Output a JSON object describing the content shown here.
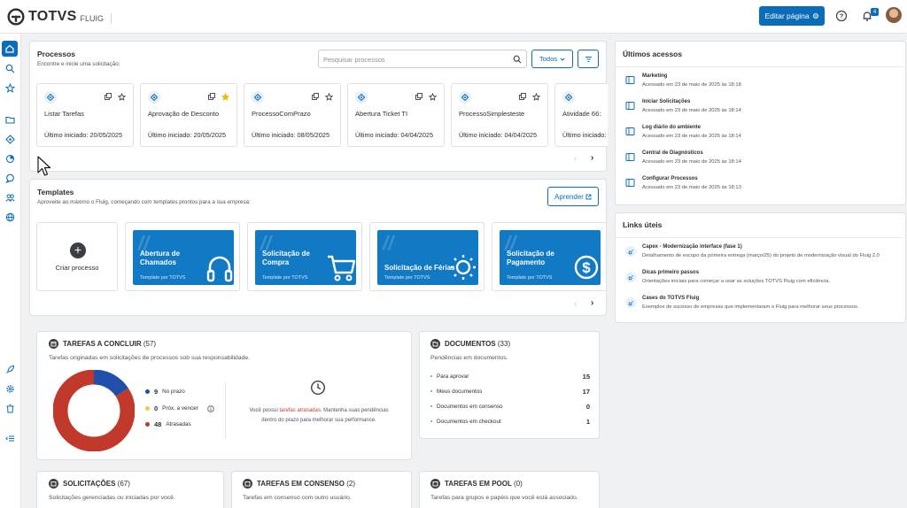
{
  "topbar": {
    "brand": "TOTVS",
    "product": "FLUIG",
    "edit_button": "Editar página",
    "notification_count": "4"
  },
  "colors": {
    "primary": "#0b6cb7",
    "no_prazo": "#1f4fa8",
    "prox_vencer": "#f2c94c",
    "atrasadas": "#c0392b"
  },
  "processes": {
    "title": "Processos",
    "subtitle": "Encontre e inicie uma solicitação:",
    "search_placeholder": "Pesquisar processos",
    "filter_label": "Todos",
    "items": [
      {
        "name": "Listar Tarefas",
        "last_started": "Último iniciado: 20/05/2025",
        "favorite": false
      },
      {
        "name": "Aprovação de Desconto",
        "last_started": "Último iniciado: 20/05/2025",
        "favorite": true
      },
      {
        "name": "ProcessoComPrazo",
        "last_started": "Último iniciado: 08/05/2025",
        "favorite": false
      },
      {
        "name": "Abertura Ticket TI",
        "last_started": "Último iniciado: 04/04/2025",
        "favorite": false
      },
      {
        "name": "ProcessoSimplesteste",
        "last_started": "Último iniciado: 04/04/2025",
        "favorite": false
      },
      {
        "name": "Atividade 66:",
        "last_started": "Último iniciado:",
        "favorite": false
      }
    ]
  },
  "templates": {
    "title": "Templates",
    "subtitle": "Aproveite ao máximo o Fluig, começando com templates prontos para a sua empresa:",
    "learn_button": "Aprender",
    "create_label": "Criar processo",
    "items": [
      {
        "name": "Abertura de Chamados",
        "by": "Template por TOTVS",
        "icon": "headset-icon"
      },
      {
        "name": "Solicitação de Compra",
        "by": "Template por TOTVS",
        "icon": "cart-icon"
      },
      {
        "name": "Solicitação de Férias",
        "by": "Template por TOTVS",
        "icon": "sun-icon"
      },
      {
        "name": "Solicitação de Pagamento",
        "by": "Template por TOTVS",
        "icon": "dollar-icon"
      }
    ]
  },
  "tasks": {
    "title": "TAREFAS A CONCLUIR",
    "count": "(57)",
    "subtitle": "Tarefas originadas em solicitações de processos sob sua responsabilidade.",
    "legend": [
      {
        "value": "9",
        "label": "No prazo"
      },
      {
        "value": "0",
        "label": "Próx. a vencer"
      },
      {
        "value": "48",
        "label": "Atrasadas"
      }
    ],
    "late_message_pre": "Você possui ",
    "late_message_link": "tarefas atrasadas",
    "late_message_post": ". Mantenha suas pendências",
    "late_message_line2": "dentro do prazo para melhorar sua performance."
  },
  "chart_data": {
    "type": "pie",
    "categories": [
      "No prazo",
      "Próx. a vencer",
      "Atrasadas"
    ],
    "values": [
      9,
      0,
      48
    ]
  },
  "documents": {
    "title": "DOCUMENTOS",
    "count": "(33)",
    "subtitle": "Pendências em documentos.",
    "rows": [
      {
        "label": "Para aprovar",
        "value": "15"
      },
      {
        "label": "Meus documentos",
        "value": "17"
      },
      {
        "label": "Documentos em consenso",
        "value": "0"
      },
      {
        "label": "Documentos em checkout",
        "value": "1"
      }
    ]
  },
  "solicitacoes": {
    "title": "SOLICITAÇÕES",
    "count": "(67)",
    "subtitle": "Solicitações gerenciadas ou iniciadas por você."
  },
  "consenso": {
    "title": "TAREFAS EM CONSENSO",
    "count": "(2)",
    "subtitle": "Tarefas em consenso com outro usuário."
  },
  "pool": {
    "title": "TAREFAS EM POOL",
    "count": "(0)",
    "subtitle": "Tarefas para grupos e papéis que você está associado."
  },
  "recent": {
    "title": "Últimos acessos",
    "items": [
      {
        "name": "Marketing",
        "date": "Acessado em 23 de maio de 2025 às 18:18"
      },
      {
        "name": "Iniciar Solicitações",
        "date": "Acessado em 23 de maio de 2025 às 18:14"
      },
      {
        "name": "Log diário do ambiente",
        "date": "Acessado em 23 de maio de 2025 às 18:14"
      },
      {
        "name": "Central de Diagnósticos",
        "date": "Acessado em 23 de maio de 2025 às 18:14"
      },
      {
        "name": "Configurar Processos",
        "date": "Acessado em 23 de maio de 2025 às 18:13"
      }
    ]
  },
  "links": {
    "title": "Links úteis",
    "items": [
      {
        "name": "Capex - Modernização interface (fase 1)",
        "desc": "Detalhamento de escopo da primeira entrega (março/25) do projeto de modernização visual do Fluig 2.0"
      },
      {
        "name": "Dicas primeiro passos",
        "desc": "Orientações iniciais para começar a usar as soluções TOTVS Fluig com eficiência."
      },
      {
        "name": "Cases do TOTVS Fluig",
        "desc": "Exemplos de sucesso de empresas que implementaram o Fluig para melhorar seus processos."
      }
    ]
  }
}
